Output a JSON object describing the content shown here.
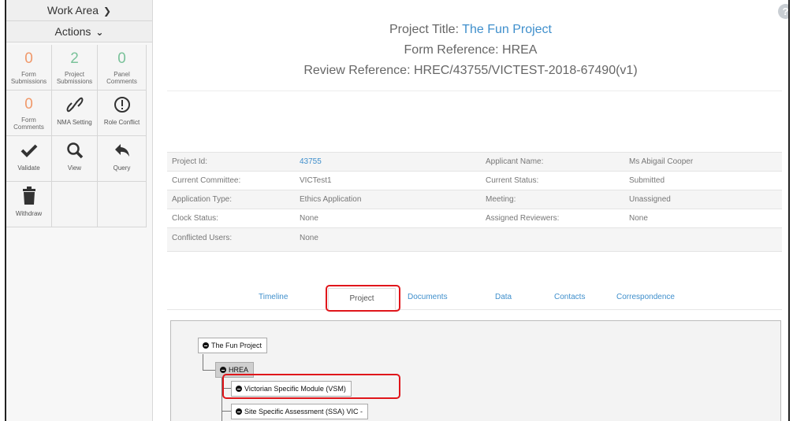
{
  "sidebar": {
    "work_area": "Work Area",
    "actions": "Actions",
    "tiles": [
      {
        "num": "0",
        "label": "Form Submissions",
        "color": "#f0996b"
      },
      {
        "num": "2",
        "label": "Project Submissions",
        "color": "#7ac29a"
      },
      {
        "num": "0",
        "label": "Panel Comments",
        "color": "#7ac29a"
      },
      {
        "num": "0",
        "label": "Form Comments",
        "color": "#f0996b"
      },
      {
        "icon": "link-icon",
        "label": "NMA Setting"
      },
      {
        "icon": "exclamation-circle-icon",
        "label": "Role Conflict"
      },
      {
        "icon": "checkmark-icon",
        "label": "Validate"
      },
      {
        "icon": "magnifier-icon",
        "label": "View"
      },
      {
        "icon": "reply-arrow-icon",
        "label": "Query"
      },
      {
        "icon": "trash-icon",
        "label": "Withdraw"
      }
    ]
  },
  "header": {
    "project_title_label": "Project Title:",
    "project_title": "The Fun Project",
    "form_reference": "Form Reference: HREA",
    "review_reference": "Review Reference: HREC/43755/VICTEST-2018-67490(v1)",
    "help": "?"
  },
  "info": [
    {
      "k1": "Project Id:",
      "v1": "43755",
      "k2": "Applicant Name:",
      "v2": "Ms Abigail Cooper"
    },
    {
      "k1": "Current Committee:",
      "v1": "VICTest1",
      "k2": "Current Status:",
      "v2": "Submitted"
    },
    {
      "k1": "Application Type:",
      "v1": "Ethics Application",
      "k2": "Meeting:",
      "v2": "Unassigned"
    },
    {
      "k1": "Clock Status:",
      "v1": "None",
      "k2": "Assigned Reviewers:",
      "v2": "None"
    },
    {
      "k1": "Conflicted Users:",
      "v1": "None",
      "k2": "",
      "v2": ""
    }
  ],
  "tabs": [
    "Timeline",
    "Project",
    "Documents",
    "Data",
    "Contacts",
    "Correspondence"
  ],
  "active_tab": "Project",
  "tree": {
    "root": "The Fun Project",
    "child": "HREA",
    "items": [
      "Victorian Specific Module (VSM)",
      "Site Specific Assessment (SSA) VIC -"
    ]
  },
  "colors": {
    "link": "#3f8fcc",
    "highlight": "#e0161b"
  }
}
